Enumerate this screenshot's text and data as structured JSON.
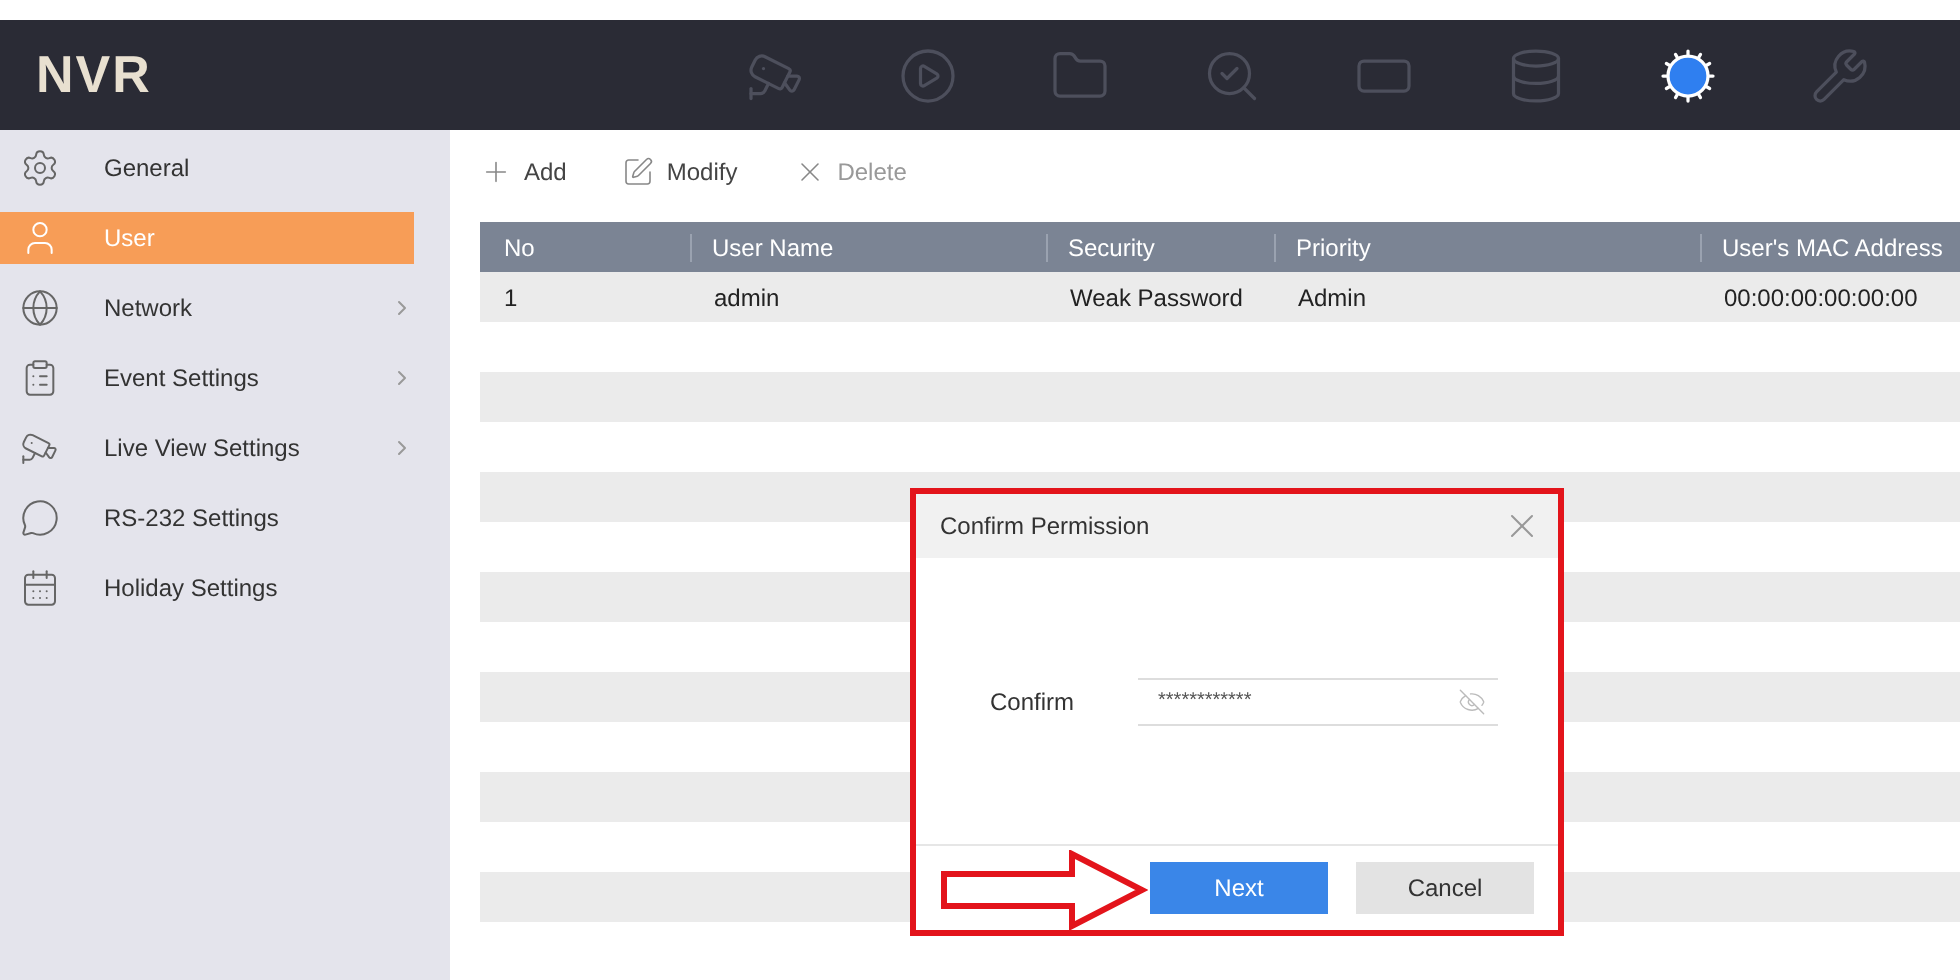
{
  "header": {
    "logo": "NVR",
    "tools": [
      {
        "selected": false
      },
      {
        "selected": false
      },
      {
        "selected": false
      },
      {
        "selected": false
      },
      {
        "selected": false
      },
      {
        "selected": false
      },
      {
        "selected": true
      },
      {
        "selected": false
      }
    ]
  },
  "sidebar": {
    "items": [
      {
        "label": "General",
        "selected": false,
        "expandable": false
      },
      {
        "label": "User",
        "selected": true,
        "expandable": false
      },
      {
        "label": "Network",
        "selected": false,
        "expandable": true
      },
      {
        "label": "Event Settings",
        "selected": false,
        "expandable": true
      },
      {
        "label": "Live View Settings",
        "selected": false,
        "expandable": true
      },
      {
        "label": "RS-232 Settings",
        "selected": false,
        "expandable": false
      },
      {
        "label": "Holiday Settings",
        "selected": false,
        "expandable": false
      }
    ]
  },
  "toolbar": [
    {
      "label": "Add",
      "disabled": false
    },
    {
      "label": "Modify",
      "disabled": false
    },
    {
      "label": "Delete",
      "disabled": true
    }
  ],
  "table": {
    "columns": [
      "No",
      "User Name",
      "Security",
      "Priority",
      "User's MAC Address"
    ],
    "rows": [
      [
        "1",
        "admin",
        "Weak Password",
        "Admin",
        "00:00:00:00:00:00"
      ]
    ]
  },
  "dialog": {
    "title": "Confirm Permission",
    "field_label": "Confirm",
    "field_value": "************",
    "buttons": [
      {
        "label": "Next",
        "primary": true
      },
      {
        "label": "Cancel",
        "primary": false
      }
    ]
  }
}
